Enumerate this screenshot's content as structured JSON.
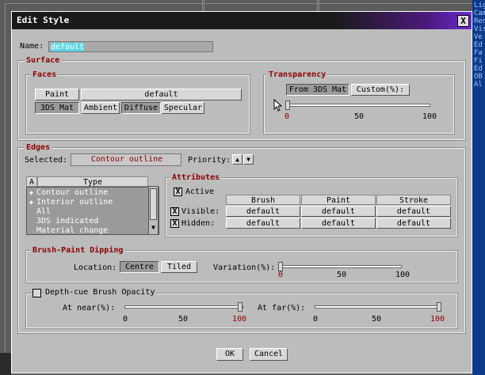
{
  "background_sidebar_lines": [
    "Lig",
    "Cam",
    "Ren",
    "Vis",
    "Ve",
    "Ed",
    "Fa",
    "Fi",
    "Ed",
    "OB",
    "Al"
  ],
  "dialog": {
    "title": "Edit Style",
    "close_label": "X"
  },
  "name": {
    "label": "Name:",
    "value": "default"
  },
  "surface": {
    "title": "Surface",
    "faces": {
      "title": "Faces",
      "paint_label": "Paint",
      "paint_value": "default",
      "buttons": [
        "3DS Mat",
        "Ambient",
        "Diffuse",
        "Specular"
      ]
    },
    "transparency": {
      "title": "Transparency",
      "buttons": [
        "From 3DS Mat",
        "Custom(%):"
      ],
      "ticks": [
        "0",
        "50",
        "100"
      ],
      "value": 0
    }
  },
  "edges": {
    "title": "Edges",
    "selected_label": "Selected:",
    "selected_value": "Contour outline",
    "priority_label": "Priority:",
    "priority_up": "▲",
    "priority_down": "▼",
    "list": {
      "col_a": "A",
      "col_type": "Type",
      "items": [
        {
          "marker": "◆",
          "label": "Contour outline"
        },
        {
          "marker": "◆",
          "label": "Interior outline"
        },
        {
          "marker": "",
          "label": "All"
        },
        {
          "marker": "",
          "label": "3DS indicated"
        },
        {
          "marker": "",
          "label": "Material change"
        }
      ]
    },
    "attributes": {
      "title": "Attributes",
      "active_label": "Active",
      "col_brush": "Brush",
      "col_paint": "Paint",
      "col_stroke": "Stroke",
      "visible_label": "Visible:",
      "hidden_label": "Hidden:",
      "visible": [
        "default",
        "default",
        "default"
      ],
      "hidden": [
        "default",
        "default",
        "default"
      ],
      "check_mark": "X"
    },
    "brush_paint": {
      "title": "Brush-Paint Dipping",
      "location_label": "Location:",
      "location_options": [
        "Centre",
        "Tiled"
      ],
      "variation_label": "Variation(%):",
      "ticks": [
        "0",
        "50",
        "100"
      ],
      "value": 0
    },
    "depth_cue": {
      "title": "Depth-cue Brush Opacity",
      "near_label": "At near(%):",
      "far_label": "At far(%):",
      "ticks": [
        "0",
        "50",
        "100"
      ],
      "near_value": 100,
      "far_value": 100
    }
  },
  "footer": {
    "ok_label": "OK",
    "cancel_label": "Cancel"
  }
}
